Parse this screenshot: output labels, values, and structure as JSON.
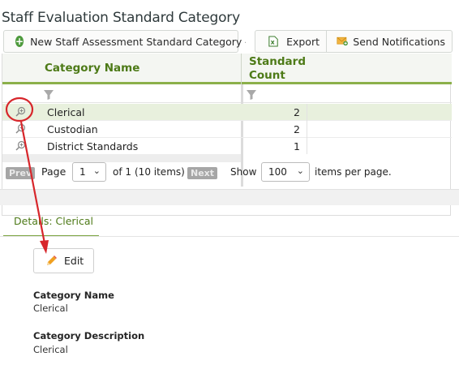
{
  "page": {
    "title": "Staff Evaluation Standard Category"
  },
  "toolbar": {
    "new_label": "New Staff Assessment Standard Category",
    "export_label": "Export",
    "notify_label": "Send Notifications"
  },
  "grid": {
    "columns": [
      "Category Name",
      "Standard",
      "Count"
    ],
    "rows": [
      {
        "name": "Clerical",
        "count": "2"
      },
      {
        "name": "Custodian",
        "count": "2"
      },
      {
        "name": "District Standards",
        "count": "1"
      }
    ],
    "pager": {
      "prev": "Prev",
      "page_label": "Page",
      "page_value": "1",
      "of_text": "of 1",
      "items_text": "(10 items)",
      "next": "Next",
      "show_label": "Show",
      "per_page_value": "100",
      "per_page_suffix": "items per page."
    }
  },
  "details": {
    "tab_label": "Details: Clerical",
    "edit_label": "Edit",
    "fields": [
      {
        "label": "Category Name",
        "value": "Clerical"
      },
      {
        "label": "Category Description",
        "value": "Clerical"
      }
    ]
  },
  "colors": {
    "accent_green": "#4d7a17",
    "header_underline": "#8cb04a",
    "annotation_red": "#d7262b"
  }
}
